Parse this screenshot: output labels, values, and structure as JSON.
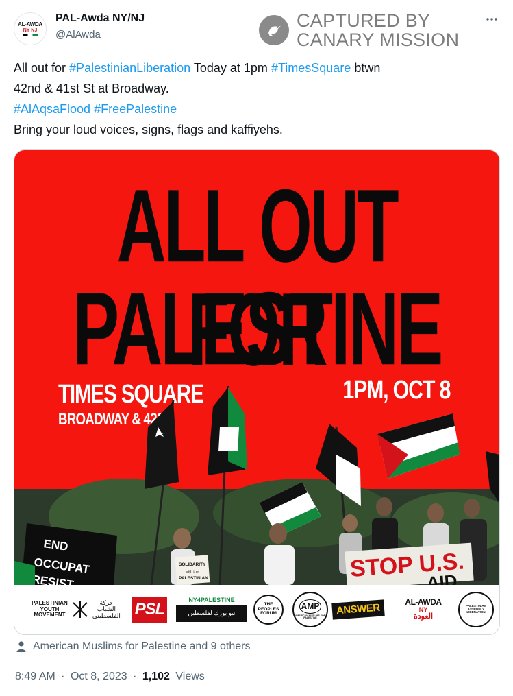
{
  "author": {
    "display_name": "PAL-Awda NY/NJ",
    "handle": "@AlAwda",
    "avatar_text": [
      "AL-AWDA",
      "NY NJ"
    ]
  },
  "watermark": {
    "line1": "CAPTURED BY",
    "line2": "CANARY MISSION"
  },
  "more_icon": "more-horizontal-icon",
  "tweet": {
    "line1": [
      {
        "text": "All out for ",
        "tag": false
      },
      {
        "text": "#PalestinianLiberation",
        "tag": true
      },
      {
        "text": " Today at 1pm ",
        "tag": false
      },
      {
        "text": "#TimesSquare",
        "tag": true
      },
      {
        "text": " btwn",
        "tag": false
      }
    ],
    "line2": [
      {
        "text": "42nd & 41st St at Broadway.",
        "tag": false
      }
    ],
    "line3": [
      {
        "text": "#AlAqsaFlood",
        "tag": true
      },
      {
        "text": " ",
        "tag": false
      },
      {
        "text": "#FreePalestine",
        "tag": true
      }
    ],
    "line4": [
      {
        "text": "Bring your loud voices, signs, flags and kaffiyehs.",
        "tag": false
      }
    ]
  },
  "poster": {
    "background": "#f5160f",
    "title_line1": "ALL OUT FOR",
    "title_line2": "PALESTINE",
    "location_line1": "TIMES SQUARE",
    "location_line2": "BROADWAY & 42ST",
    "datetime": "1PM, OCT 8",
    "signs": {
      "banner_left": [
        "END",
        "OCCUPAT",
        "RESIST"
      ],
      "solidarity_sign": [
        "SOLIDARITY",
        "with the",
        "PALESTINIAN"
      ],
      "stop_sign": "STOP U.S.",
      "stop_sign_line2": "AID"
    },
    "logos": {
      "pym": [
        "PALESTINIAN",
        "YOUTH",
        "MOVEMENT"
      ],
      "pym_arabic": [
        "حركة",
        "الشباب",
        "الفلسطيني"
      ],
      "psl": "PSL",
      "ny4p": "NY4PALESTINE",
      "ny4p_arabic": "نيو يورك لفلسطين",
      "peoples_forum": [
        "THE",
        "PEOPLES",
        "FORUM"
      ],
      "amp": "AMP",
      "amp_sub": "AMERICAN MUSLIMS FOR PALESTINE",
      "answer": "ANSWER",
      "alawda": [
        "AL-AWDA",
        "NY"
      ],
      "alawda_arabic": "العودة",
      "pal": [
        "PALESTINIAN",
        "ASSEMBLY",
        "LIBERATION"
      ]
    }
  },
  "reply_note": "American Muslims for Palestine and 9 others",
  "meta": {
    "time": "8:49 AM",
    "date": "Oct 8, 2023",
    "separator": "·",
    "views_count": "1,102",
    "views_label": "Views"
  },
  "colors": {
    "text": "#0f1419",
    "secondary": "#536471",
    "link": "#1d9bf0",
    "border": "#cfd9de",
    "poster_red": "#f5160f",
    "flag_green": "#128a3e"
  }
}
